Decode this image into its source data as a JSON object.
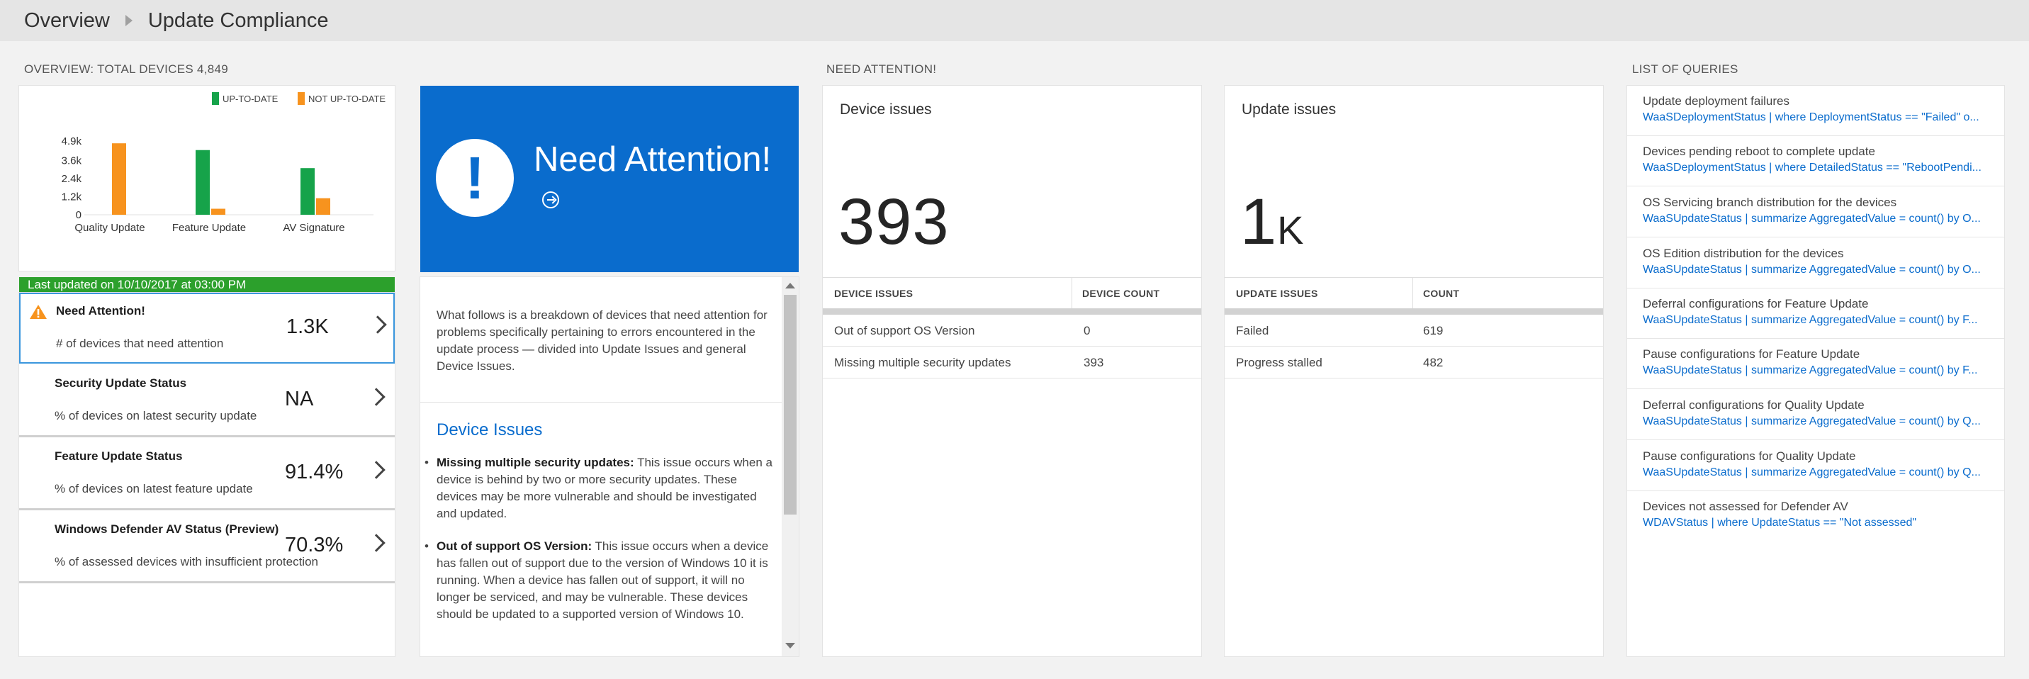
{
  "breadcrumb": {
    "items": [
      "Overview",
      "Update Compliance"
    ]
  },
  "sections": {
    "overview": "OVERVIEW: TOTAL DEVICES 4,849",
    "attention": "NEED ATTENTION!",
    "queries": "LIST OF QUERIES"
  },
  "colors": {
    "up_to_date": "#16a34a",
    "not_up_to_date": "#f7931e",
    "accent": "#0a6ccd",
    "status_green": "#2ca02c"
  },
  "chart_data": {
    "type": "bar",
    "categories": [
      "Quality Update",
      "Feature Update",
      "AV Signature"
    ],
    "series": [
      {
        "name": "UP-TO-DATE",
        "values": [
          0,
          4300,
          3100
        ]
      },
      {
        "name": "NOT UP-TO-DATE",
        "values": [
          4750,
          400,
          1100
        ]
      }
    ],
    "yticks": [
      "0",
      "1.2k",
      "2.4k",
      "3.6k",
      "4.9k"
    ],
    "ytick_values": [
      0,
      1200,
      2400,
      3600,
      4900
    ],
    "ylim": [
      0,
      4900
    ],
    "legend": "top-right"
  },
  "status_bar": "Last updated on 10/10/2017 at 03:00 PM",
  "status_items": [
    {
      "title": "Need Attention!",
      "desc": "# of devices that need attention",
      "value": "1.3K",
      "icon": "warning-icon"
    },
    {
      "title": "Security Update Status",
      "desc": "% of devices on latest security update",
      "value": "NA"
    },
    {
      "title": "Feature Update Status",
      "desc": "% of devices on latest feature update",
      "value": "91.4%"
    },
    {
      "title": "Windows Defender AV Status (Preview)",
      "desc": "% of assessed devices with insufficient protection",
      "value": "70.3%"
    }
  ],
  "attention_tile": {
    "title": "Need Attention!",
    "icon": "exclamation-icon"
  },
  "description": {
    "intro": "What follows is a breakdown of devices that need attention for problems specifically pertaining to errors encountered in the update process — divided into Update Issues and general Device Issues.",
    "heading": "Device Issues",
    "bullets": [
      {
        "bold": "Missing multiple security updates:",
        "text": " This issue occurs when a device is behind by two or more security updates. These devices may be more vulnerable and should be investigated and updated."
      },
      {
        "bold": "Out of support OS Version:",
        "text": " This issue occurs when a device has fallen out of support due to the version of Windows 10 it is running. When a device has fallen out of support, it will no longer be serviced, and may be vulnerable. These devices should be updated to a supported version of Windows 10."
      }
    ]
  },
  "device_issues": {
    "title": "Device issues",
    "big_number": "393",
    "columns": [
      "DEVICE ISSUES",
      "DEVICE COUNT"
    ],
    "rows": [
      [
        "Out of support OS Version",
        "0"
      ],
      [
        "Missing multiple security updates",
        "393"
      ]
    ]
  },
  "update_issues": {
    "title": "Update issues",
    "big_number": "1",
    "big_suffix": "K",
    "columns": [
      "UPDATE ISSUES",
      "COUNT"
    ],
    "rows": [
      [
        "Failed",
        "619"
      ],
      [
        "Progress stalled",
        "482"
      ]
    ]
  },
  "queries": [
    {
      "title": "Update deployment failures",
      "code": "WaaSDeploymentStatus | where DeploymentStatus == \"Failed\" o..."
    },
    {
      "title": "Devices pending reboot to complete update",
      "code": "WaaSDeploymentStatus | where DetailedStatus == \"RebootPendi..."
    },
    {
      "title": "OS Servicing branch distribution for the devices",
      "code": "WaaSUpdateStatus | summarize AggregatedValue = count() by O..."
    },
    {
      "title": "OS Edition distribution for the devices",
      "code": "WaaSUpdateStatus | summarize AggregatedValue = count() by O..."
    },
    {
      "title": "Deferral configurations for Feature Update",
      "code": "WaaSUpdateStatus | summarize AggregatedValue = count() by F..."
    },
    {
      "title": "Pause configurations for Feature Update",
      "code": "WaaSUpdateStatus | summarize AggregatedValue = count() by F..."
    },
    {
      "title": "Deferral configurations for Quality Update",
      "code": "WaaSUpdateStatus | summarize AggregatedValue = count() by Q..."
    },
    {
      "title": "Pause configurations for Quality Update",
      "code": "WaaSUpdateStatus | summarize AggregatedValue = count() by Q..."
    },
    {
      "title": "Devices not assessed for Defender AV",
      "code": "WDAVStatus | where UpdateStatus == \"Not assessed\""
    }
  ]
}
